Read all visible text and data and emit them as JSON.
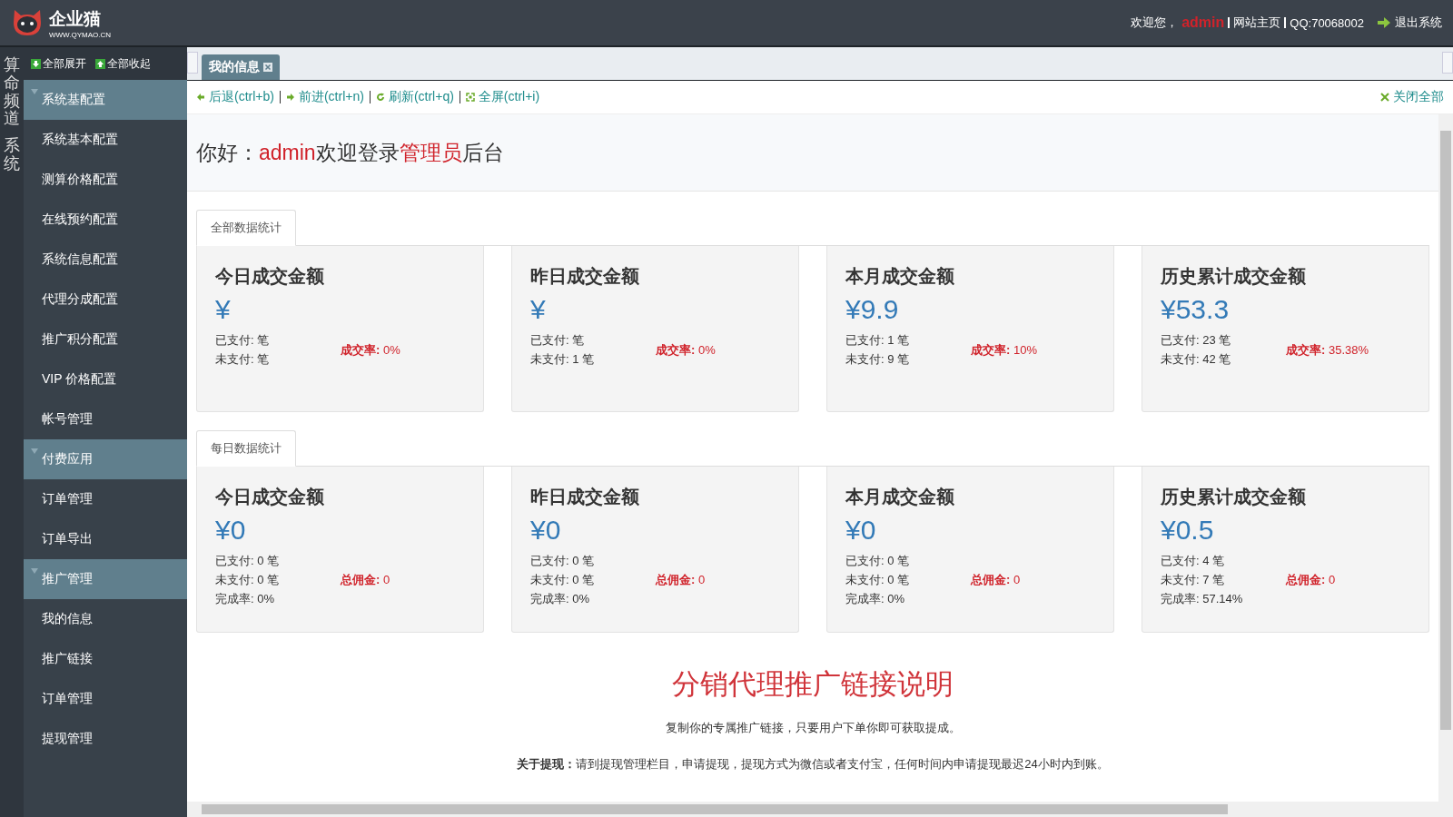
{
  "header": {
    "logo_name": "企业猫",
    "logo_url": "WWW.QYMAO.CN",
    "welcome": "欢迎您，",
    "user": "admin",
    "home_link": "网站主页",
    "qq": "QQ:70068002",
    "logout": "退出系统"
  },
  "side_tabs": [
    "算命频道",
    "系统"
  ],
  "sidebar": {
    "expand_all": "全部展开",
    "collapse_all": "全部收起",
    "groups": [
      {
        "label": "系统基配置",
        "items": [
          "系统基本配置",
          "测算价格配置",
          "在线预约配置",
          "系统信息配置",
          "代理分成配置",
          "推广积分配置",
          "VIP 价格配置",
          "帐号管理"
        ]
      },
      {
        "label": "付费应用",
        "items": [
          "订单管理",
          "订单导出"
        ]
      },
      {
        "label": "推广管理",
        "items": [
          "我的信息",
          "推广链接",
          "订单管理",
          "提现管理"
        ]
      }
    ]
  },
  "tabs": [
    {
      "label": "我的信息",
      "selected": true
    }
  ],
  "toolbar": [
    {
      "kind": "back",
      "label": "后退(ctrl+b)"
    },
    {
      "kind": "forward",
      "label": "前进(ctrl+n)"
    },
    {
      "kind": "refresh",
      "label": "刷新(ctrl+q)"
    },
    {
      "kind": "fullscreen",
      "label": "全屏(ctrl+i)"
    }
  ],
  "close_all": "关闭全部",
  "greeting": {
    "prefix": "你好：",
    "user": "admin",
    "middle": "欢迎登录",
    "role": "管理员",
    "suffix": "后台"
  },
  "sections": [
    {
      "tab": "全部数据统计",
      "cards": [
        {
          "title": "今日成交金额",
          "amount": "¥",
          "lines": [
            "已支付: 笔",
            "未支付: 笔"
          ],
          "stat_label": "成交率:",
          "stat_value": "0%"
        },
        {
          "title": "昨日成交金额",
          "amount": "¥",
          "lines": [
            "已支付: 笔",
            "未支付: 1 笔"
          ],
          "stat_label": "成交率:",
          "stat_value": "0%"
        },
        {
          "title": "本月成交金额",
          "amount": "¥9.9",
          "lines": [
            "已支付: 1 笔",
            "未支付: 9 笔"
          ],
          "stat_label": "成交率:",
          "stat_value": "10%"
        },
        {
          "title": "历史累计成交金额",
          "amount": "¥53.3",
          "lines": [
            "已支付: 23 笔",
            "未支付: 42 笔"
          ],
          "stat_label": "成交率:",
          "stat_value": "35.38%"
        }
      ]
    },
    {
      "tab": "每日数据统计",
      "cards": [
        {
          "title": "今日成交金额",
          "amount": "¥0",
          "lines": [
            "已支付: 0 笔",
            "未支付: 0 笔",
            "完成率: 0%"
          ],
          "stat_label": "总佣金:",
          "stat_value": "0"
        },
        {
          "title": "昨日成交金额",
          "amount": "¥0",
          "lines": [
            "已支付: 0 笔",
            "未支付: 0 笔",
            "完成率: 0%"
          ],
          "stat_label": "总佣金:",
          "stat_value": "0"
        },
        {
          "title": "本月成交金额",
          "amount": "¥0",
          "lines": [
            "已支付: 0 笔",
            "未支付: 0 笔",
            "完成率: 0%"
          ],
          "stat_label": "总佣金:",
          "stat_value": "0"
        },
        {
          "title": "历史累计成交金额",
          "amount": "¥0.5",
          "lines": [
            "已支付: 4 笔",
            "未支付: 7 笔",
            "完成率: 57.14%"
          ],
          "stat_label": "总佣金:",
          "stat_value": "0"
        }
      ]
    }
  ],
  "notice": {
    "title": "分销代理推广链接说明",
    "line": "复制你的专属推广链接，只要用户下单你即可获取提成。",
    "detail": "**关于提现：**请到提现管理栏目，申请提现，提现方式为微信或者支付宝，任何时间内申请提现最迟24小时内到账。"
  }
}
